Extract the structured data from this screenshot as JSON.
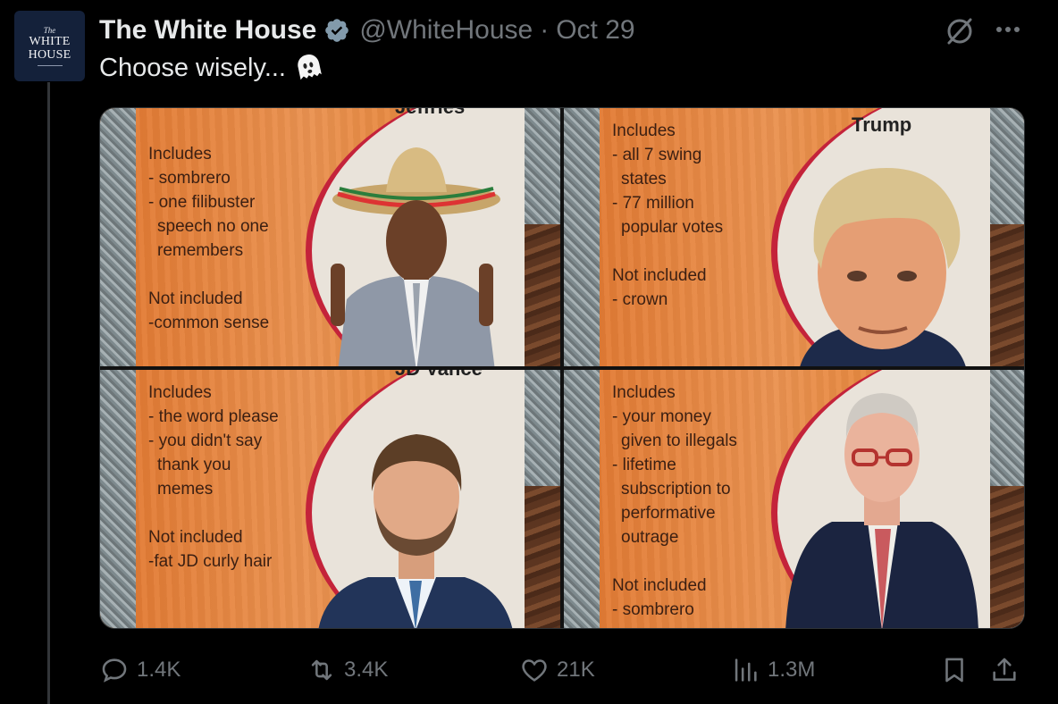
{
  "tweet": {
    "display_name": "The White House",
    "handle": "@WhiteHouse",
    "separator": "·",
    "date": "Oct 29",
    "text": "Choose wisely...",
    "avatar": {
      "the": "The",
      "line1": "WHITE",
      "line2": "HOUSE"
    },
    "colors": {
      "background": "#000000",
      "muted": "#71767b",
      "verified": "#829aab"
    }
  },
  "media": {
    "panels": [
      {
        "name": "Jeffries",
        "lines": [
          "Includes",
          "- sombrero",
          "- one filibuster",
          "  speech no one",
          "  remembers",
          "",
          "Not included",
          "-common sense"
        ]
      },
      {
        "name": "Trump",
        "lines": [
          "Includes",
          "- all 7 swing",
          "  states",
          "- 77 million",
          "  popular votes",
          "",
          "Not included",
          "- crown"
        ]
      },
      {
        "name": "JD Vance",
        "lines": [
          "Includes",
          "- the word please",
          "- you didn't say",
          "  thank you",
          "  memes",
          "",
          "Not included",
          "-fat JD curly hair"
        ]
      },
      {
        "name": "",
        "lines": [
          "Includes",
          "- your money",
          "  given to illegals",
          "- lifetime",
          "  subscription to",
          "  performative",
          "  outrage",
          "",
          "Not included",
          "- sombrero"
        ]
      }
    ]
  },
  "actions": {
    "replies": "1.4K",
    "reposts": "3.4K",
    "likes": "21K",
    "views": "1.3M",
    "icons": [
      "reply-icon",
      "repost-icon",
      "like-icon",
      "views-icon",
      "bookmark-icon",
      "share-icon"
    ]
  }
}
